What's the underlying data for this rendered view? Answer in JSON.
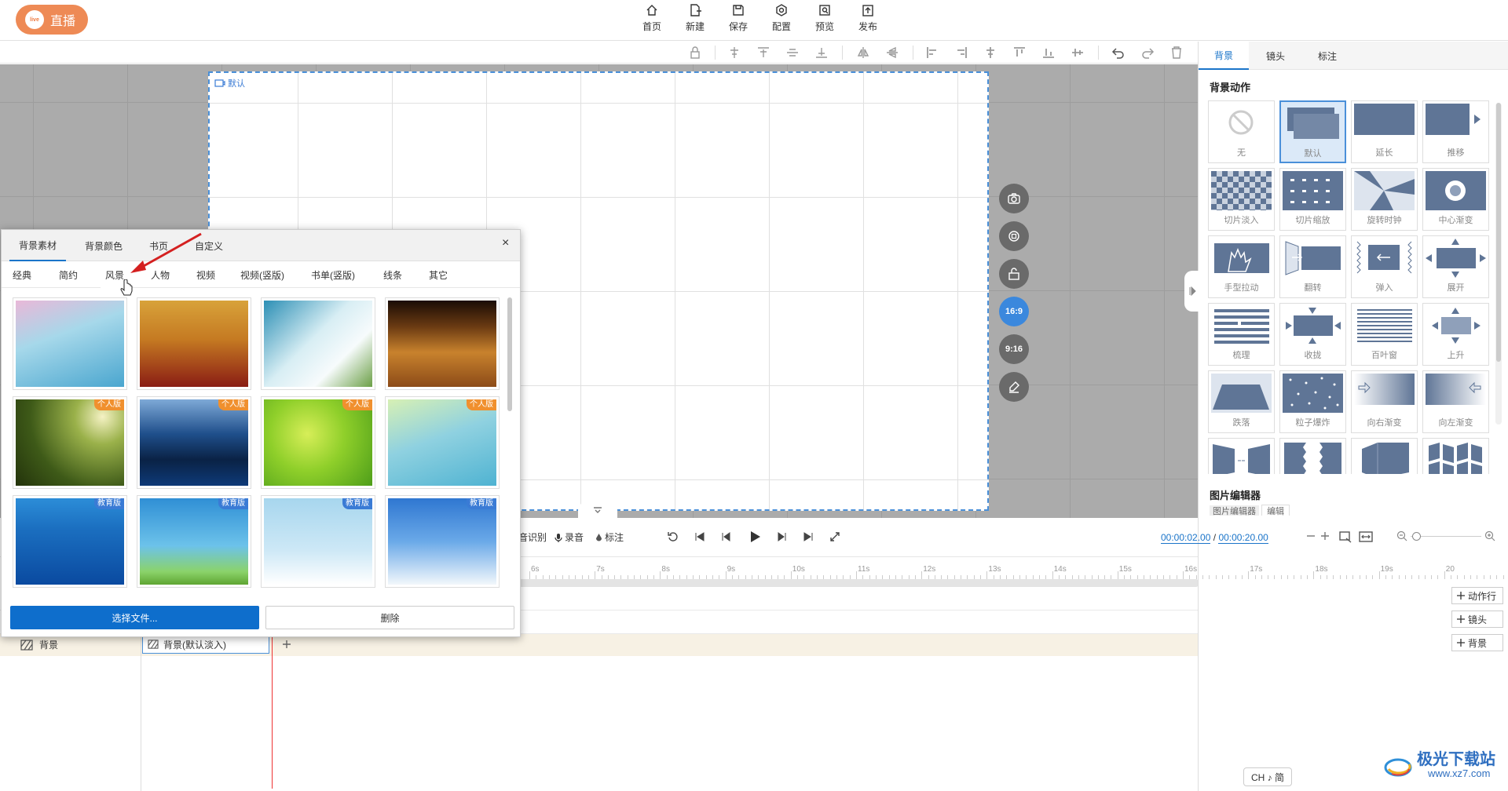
{
  "app": {
    "logo_text": "直播",
    "logo_icon": "live"
  },
  "top_nav": [
    {
      "label": "首页",
      "icon": "home-icon"
    },
    {
      "label": "新建",
      "icon": "new-file-icon"
    },
    {
      "label": "保存",
      "icon": "save-icon"
    },
    {
      "label": "配置",
      "icon": "settings-icon"
    },
    {
      "label": "预览",
      "icon": "preview-icon"
    },
    {
      "label": "发布",
      "icon": "publish-icon"
    }
  ],
  "canvas": {
    "stage_label": "默认",
    "side_buttons": [
      "camera-icon",
      "rotate-icon",
      "unlock-icon",
      "16:9",
      "9:16",
      "eraser-icon"
    ],
    "active_ratio": "16:9"
  },
  "right_panel": {
    "tabs": [
      "背景",
      "镜头",
      "标注"
    ],
    "active_tab": "背景",
    "section_title": "背景动作",
    "effects": [
      "无",
      "默认",
      "延长",
      "推移",
      "切片淡入",
      "切片缩放",
      "旋转时钟",
      "中心渐变",
      "手型拉动",
      "翻转",
      "弹入",
      "展开",
      "梳理",
      "收拢",
      "百叶窗",
      "上升",
      "跌落",
      "粒子爆炸",
      "向右渐变",
      "向左渐变",
      "",
      "",
      "",
      ""
    ],
    "selected_effect": "默认",
    "image_editor_title": "图片编辑器",
    "image_editor_tabs": [
      "图片编辑器",
      "编辑"
    ]
  },
  "popup": {
    "tabs": [
      "背景素材",
      "背景颜色",
      "书页",
      "自定义"
    ],
    "active_tab": "背景素材",
    "close": "×",
    "sub_tabs": [
      "经典",
      "简约",
      "风景",
      "人物",
      "视频",
      "视频(竖版)",
      "书单(竖版)",
      "线条",
      "其它"
    ],
    "active_sub_tab": "风景",
    "images": [
      {
        "badge": ""
      },
      {
        "badge": ""
      },
      {
        "badge": ""
      },
      {
        "badge": ""
      },
      {
        "badge": "个人版"
      },
      {
        "badge": "个人版"
      },
      {
        "badge": "个人版"
      },
      {
        "badge": "个人版"
      },
      {
        "badge": "教育版"
      },
      {
        "badge": "教育版"
      },
      {
        "badge": "教育版"
      },
      {
        "badge": "教育版"
      }
    ],
    "select_button": "选择文件...",
    "delete_button": "删除"
  },
  "timeline": {
    "controls": {
      "speech": "音识别",
      "record": "录音",
      "annotate": "标注"
    },
    "current_time": "00:00:02.00",
    "separator": "/",
    "total_time": "00:00:20.00",
    "ticks": [
      "6s",
      "7s",
      "8s",
      "9s",
      "10s",
      "11s",
      "12s",
      "13s",
      "14s",
      "15s",
      "16s",
      "17s",
      "18s",
      "19s",
      "20"
    ],
    "bg_track_label": "背景",
    "bg_clip_label": "背景(默认淡入)",
    "add_buttons": [
      "动作行",
      "镜头",
      "背景"
    ]
  },
  "ime": "CH ♪ 简",
  "watermark": {
    "line1": "极光下载站",
    "line2": "www.xz7.com"
  }
}
